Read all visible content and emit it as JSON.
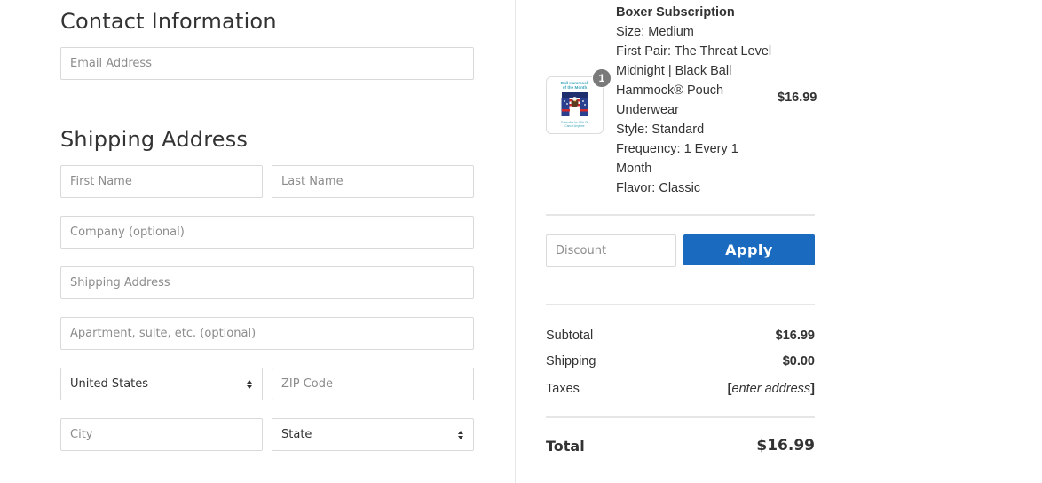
{
  "contact": {
    "title": "Contact Information",
    "email_placeholder": "Email Address"
  },
  "shipping": {
    "title": "Shipping Address",
    "first_name_placeholder": "First Name",
    "last_name_placeholder": "Last Name",
    "company_placeholder": "Company (optional)",
    "address_placeholder": "Shipping Address",
    "apartment_placeholder": "Apartment, suite, etc. (optional)",
    "country_value": "United States",
    "zip_placeholder": "ZIP Code",
    "city_placeholder": "City",
    "state_value": "State"
  },
  "order": {
    "item": {
      "name": "Boxer Subscription",
      "quantity": "1",
      "price": "$16.99",
      "details": [
        "Size: Medium",
        "First Pair: The Threat Level Midnight | Black Ball Hammock® Pouch Underwear",
        "Style: Standard",
        "Frequency: 1 Every 1 Month",
        "Flavor: Classic"
      ],
      "thumbnail_text": "Ball Hammock of the Month"
    },
    "discount_placeholder": "Discount",
    "apply_label": "Apply",
    "apply_color": "#1a6bbf",
    "subtotal_label": "Subtotal",
    "subtotal_value": "$16.99",
    "shipping_label": "Shipping",
    "shipping_value": "$0.00",
    "taxes_label": "Taxes",
    "taxes_value": "enter address",
    "total_label": "Total",
    "total_value": "$16.99"
  }
}
